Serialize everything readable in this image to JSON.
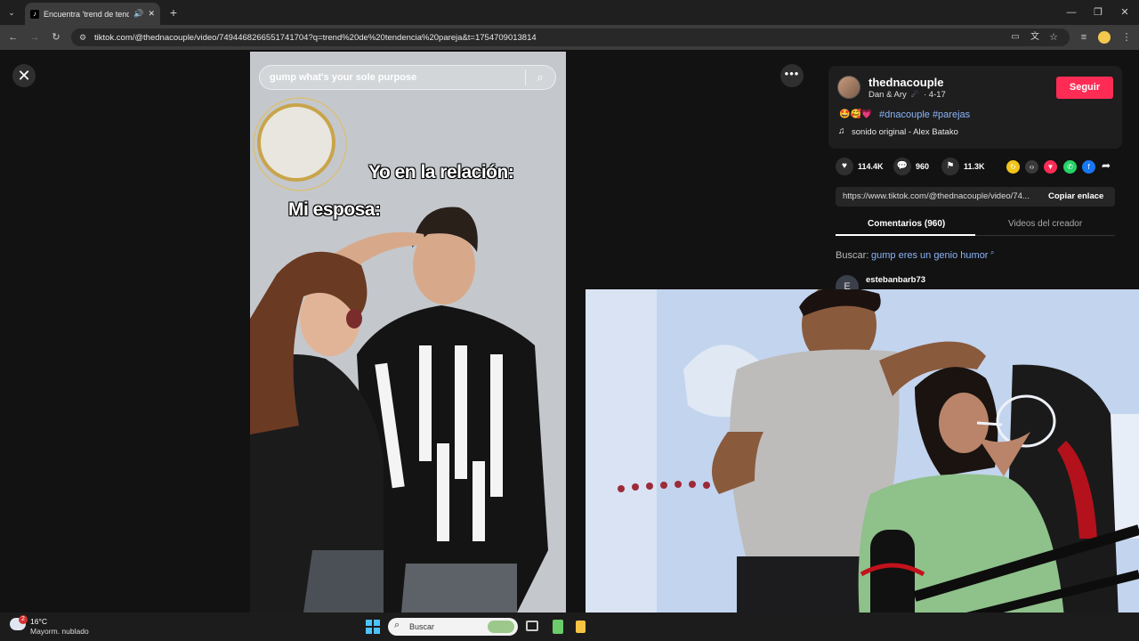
{
  "browser": {
    "tab": {
      "title": "Encuentra 'trend de tenden",
      "close_glyph": "✕"
    },
    "new_tab_glyph": "+",
    "window_controls": {
      "minimize": "—",
      "restore": "❐",
      "close": "✕"
    },
    "url": "tiktok.com/@thednacouple/video/7494468266551741704?q=trend%20de%20tendencia%20pareja&t=1754709013814"
  },
  "video": {
    "search_text": "gump what's your sole purpose",
    "caption_1": "Yo en la relación:",
    "caption_2": "Mi esposa:"
  },
  "author": {
    "username": "thednacouple",
    "nickname": "Dan & Ary",
    "date_suffix": "· 4-17",
    "follow_label": "Seguir"
  },
  "post": {
    "emojis": "🤩🥰💗",
    "hashtags": "#dnacouple #parejas",
    "sound": "sonido original - Alex Batako"
  },
  "actions": {
    "likes": "114.4K",
    "comments": "960",
    "saves": "11.3K"
  },
  "share": {
    "link": "https://www.tiktok.com/@thednacouple/video/74...",
    "copy_label": "Copiar enlace"
  },
  "tabs": {
    "comments": "Comentarios (960)",
    "creator": "Videos del creador"
  },
  "search_suggestion": {
    "prefix": "Buscar:",
    "query": "gump eres un genio humor"
  },
  "comment": {
    "avatar_letter": "E",
    "username": "estebanbarb73"
  },
  "taskbar": {
    "weather_temp": "16°C",
    "weather_desc": "Mayorm. nublado",
    "weather_badge": "2",
    "search_placeholder": "Buscar"
  },
  "colors": {
    "follow": "#fe2c55",
    "hashtag": "#8ab4f8",
    "bg": "#121212"
  }
}
